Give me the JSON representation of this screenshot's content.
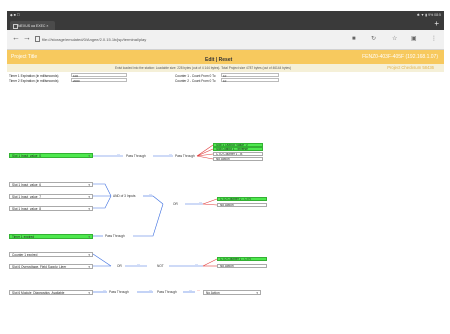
{
  "status_bar": {
    "left": "◆ ■ ☐",
    "right": "✱ ▼ ▮ 9% 08:5"
  },
  "tab": {
    "title": "NEXUS ua EXEC ×"
  },
  "address_bar": {
    "url": "file:///storage/emulated/0/Angee/2.0.15.1b/jsp/terminal/play"
  },
  "banner": {
    "title": "Project Title",
    "edit_label": "Edit",
    "reset_label": "Reset",
    "ip": "FENZ0-403F-405F (192.168.1.07)"
  },
  "info": {
    "stats": "Exist loaded into the station: Loadable size: 228 bytes (out of 4 144 bytes). Total Project size 4787 bytes (out of 46144 bytes)",
    "checksum": "Project Checksum 58436"
  },
  "fields": {
    "timer1_label": "Timer 1 Expiration (in milliseconds)",
    "timer1_value": "100",
    "timer2_label": "Timer 2 Expiration (in milliseconds)",
    "timer2_value": "2000",
    "counter1_label": "Counter 1 - Count From 0 To",
    "counter1_value": "10",
    "counter2_label": "Counter 2 - Count From 0 To",
    "counter2_value": "10"
  },
  "rows": {
    "r1": {
      "input": "Slot 1 Input_value_0",
      "op1": "Pass Through",
      "op2": "Pass Through",
      "outputs": [
        "Slot 1 Output_value_0",
        "Slot Output 1 - Inverse",
        "CTU Counter 1 - B",
        "No Action"
      ]
    },
    "r2": {
      "inputs": [
        "Slot 1 Input_value_6",
        "Slot 1 Input_value_7",
        "Slot 1 Input_value_8"
      ],
      "gate1": "AND of 3 Inputs",
      "gate2": "OR",
      "outputs": [
        "CTU Counter 2 - CTR",
        "No Action"
      ],
      "timer_input": "Timer 1 expired",
      "timer_op": "Pass Through"
    },
    "r3": {
      "inputs": [
        "Counter 1 expired",
        "Slot 6 Overvoltage, Field Supply, Lleer"
      ],
      "gate1": "OR",
      "gate2": "NOT",
      "outputs": [
        "CTU Counter 1 - CTR",
        "No Action"
      ]
    },
    "r4": {
      "input": "Slot 6 Module_Diagnostics_Available",
      "op1": "Pass Through",
      "op2": "Pass Through",
      "output": "No Action"
    }
  },
  "colors": {
    "banner": "#f7c95e",
    "active_node": "#4ee84e",
    "wire_blue": "#3a6de0",
    "wire_red": "#e03a3a"
  }
}
